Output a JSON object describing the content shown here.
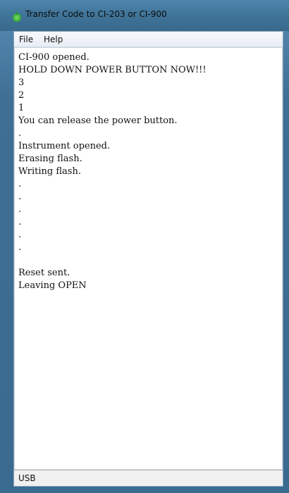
{
  "window": {
    "title": "Transfer Code to CI-203 or CI-900",
    "icon": "green-app-icon"
  },
  "menu": {
    "items": [
      "File",
      "Help"
    ]
  },
  "console": {
    "lines": [
      "CI-900 opened.",
      "HOLD DOWN POWER BUTTON NOW!!!",
      "3",
      "2",
      "1",
      "You can release the power button.",
      ".",
      "Instrument opened.",
      "Erasing flash.",
      "Writing flash.",
      ".",
      ".",
      ".",
      ".",
      ".",
      ".",
      "",
      "Reset sent.",
      "Leaving OPEN"
    ]
  },
  "status": {
    "text": "USB"
  },
  "colors": {
    "titlebar": "#3e7296",
    "console_bg": "#ffffff",
    "statusbar": "#f0f0f0"
  }
}
